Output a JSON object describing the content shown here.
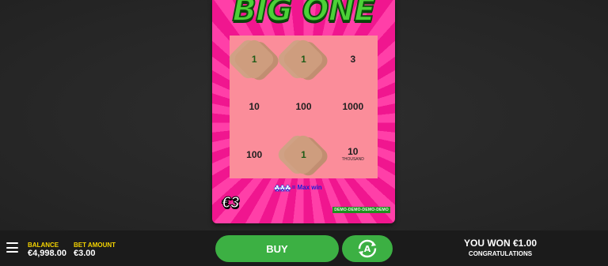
{
  "game": {
    "title": "BIG ONE",
    "price": "€3",
    "max_win_label": "= Max win",
    "max_win_symbol": "♣♣♣",
    "demo_label": "DEMO-DEMO-DEMO-DEMO"
  },
  "grid": [
    {
      "value": "1",
      "sub": "",
      "scratched": true
    },
    {
      "value": "1",
      "sub": "",
      "scratched": true
    },
    {
      "value": "3",
      "sub": "",
      "scratched": false
    },
    {
      "value": "10",
      "sub": "",
      "scratched": false
    },
    {
      "value": "100",
      "sub": "",
      "scratched": false
    },
    {
      "value": "1000",
      "sub": "",
      "scratched": false
    },
    {
      "value": "100",
      "sub": "",
      "scratched": false
    },
    {
      "value": "1",
      "sub": "",
      "scratched": true
    },
    {
      "value": "10",
      "sub": "THOUSAND",
      "scratched": false
    }
  ],
  "bottombar": {
    "balance_label": "BALANCE",
    "balance_value": "€4,998.00",
    "bet_label": "BET AMOUNT",
    "bet_value": "€3.00",
    "buy_label": "BUY",
    "win_text": "YOU WON €1.00",
    "win_subtext": "CONGRATULATIONS"
  },
  "colors": {
    "card_pink": "#f0168f",
    "grid_bg": "#fb8d9a",
    "button_green": "#3cb043",
    "label_yellow": "#f5d400"
  },
  "icons": {
    "menu": "hamburger-menu-icon",
    "autoplay": "autoplay-icon"
  }
}
